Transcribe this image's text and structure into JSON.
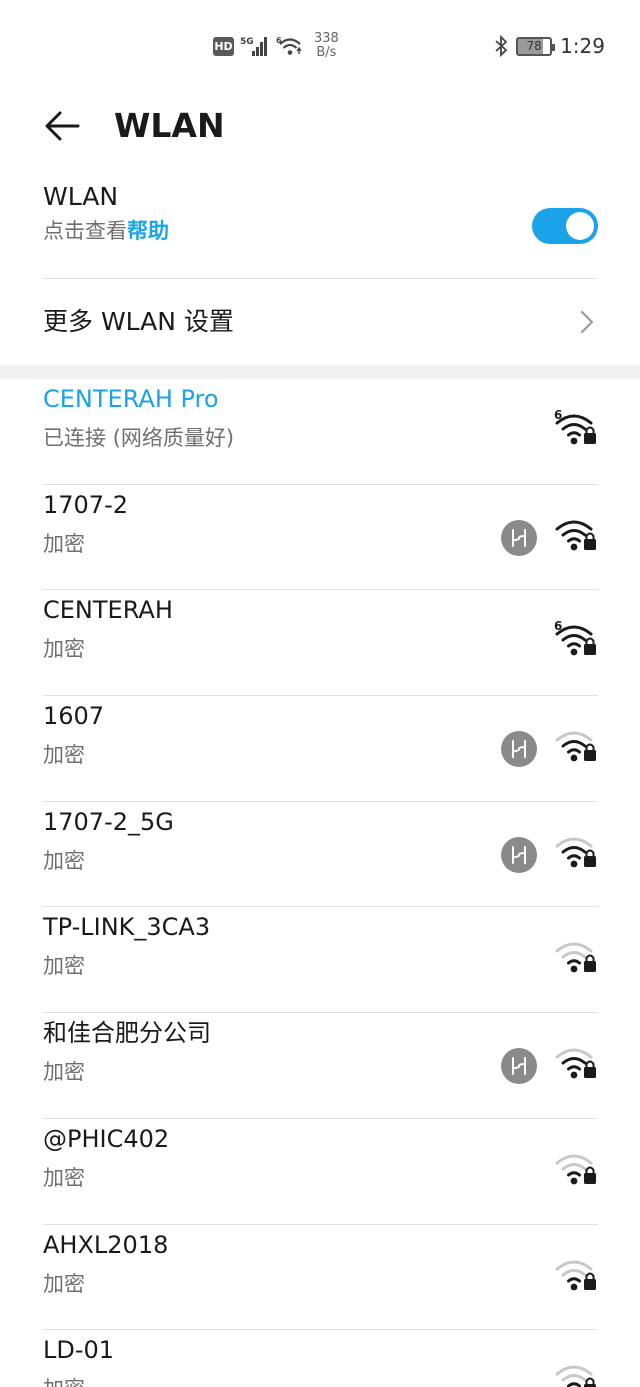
{
  "status_bar": {
    "hd": "HD",
    "network_type": "5G",
    "wifi_gen": "6",
    "speed_value": "338",
    "speed_unit": "B/s",
    "battery": "78",
    "time": "1:29"
  },
  "header": {
    "title": "WLAN"
  },
  "wlan_toggle": {
    "label": "WLAN",
    "hint_prefix": "点击查看",
    "hint_link": "帮助",
    "enabled": true,
    "accent_color": "#1aa3e8"
  },
  "more_settings": {
    "label": "更多 WLAN 设置"
  },
  "networks": [
    {
      "name": "CENTERAH Pro",
      "status": "已连接 (网络质量好)",
      "connected": true,
      "wifi6": true,
      "strength": "strong",
      "shared": false
    },
    {
      "name": "1707-2",
      "status": "加密",
      "connected": false,
      "wifi6": false,
      "strength": "strong",
      "shared": true
    },
    {
      "name": "CENTERAH",
      "status": "加密",
      "connected": false,
      "wifi6": true,
      "strength": "strong",
      "shared": false
    },
    {
      "name": "1607",
      "status": "加密",
      "connected": false,
      "wifi6": false,
      "strength": "medium",
      "shared": true
    },
    {
      "name": "1707-2_5G",
      "status": "加密",
      "connected": false,
      "wifi6": false,
      "strength": "medium",
      "shared": true
    },
    {
      "name": "TP-LINK_3CA3",
      "status": "加密",
      "connected": false,
      "wifi6": false,
      "strength": "weak",
      "shared": false
    },
    {
      "name": "和佳合肥分公司",
      "status": "加密",
      "connected": false,
      "wifi6": false,
      "strength": "medium",
      "shared": true
    },
    {
      "name": "@PHIC402",
      "status": "加密",
      "connected": false,
      "wifi6": false,
      "strength": "weak",
      "shared": false
    },
    {
      "name": "AHXL2018",
      "status": "加密",
      "connected": false,
      "wifi6": false,
      "strength": "weak",
      "shared": false
    },
    {
      "name": "LD-01",
      "status": "加密",
      "connected": false,
      "wifi6": false,
      "strength": "weak",
      "shared": false
    }
  ]
}
